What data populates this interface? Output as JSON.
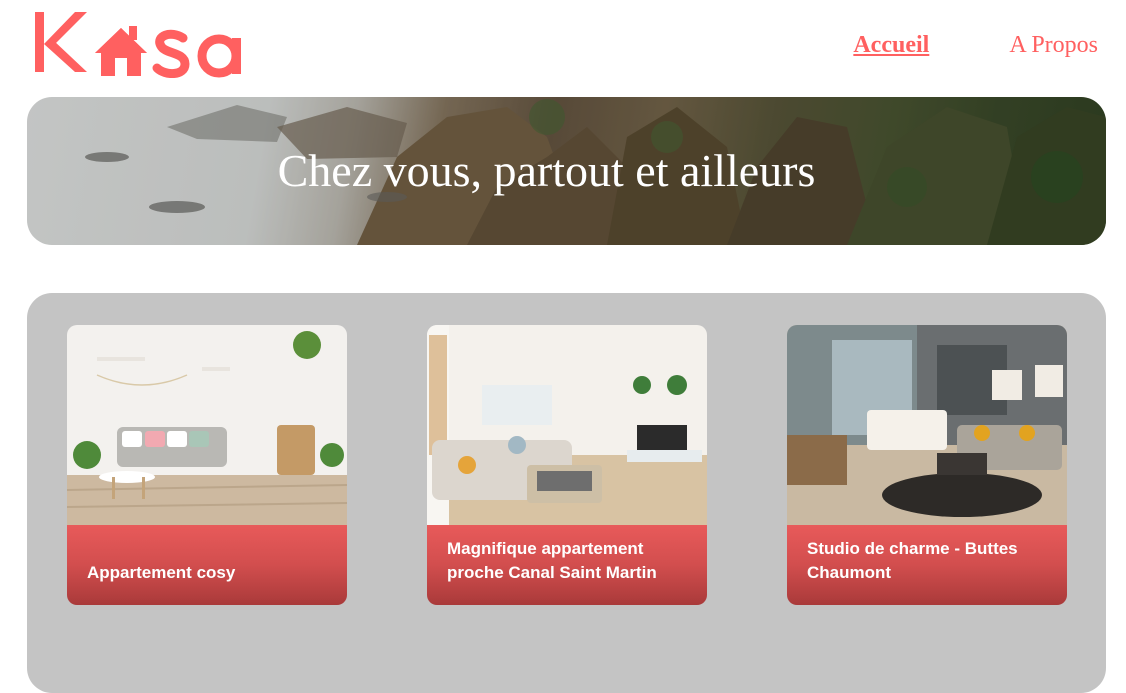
{
  "brand": {
    "name": "Kasa",
    "color": "#FF6060"
  },
  "nav": [
    {
      "label": "Accueil",
      "active": true
    },
    {
      "label": "A Propos",
      "active": false
    }
  ],
  "banner": {
    "title": "Chez vous, partout et ailleurs"
  },
  "colors": {
    "gallery_bg": "#C4C4C4",
    "caption_gradient_top": "#E85A5A",
    "caption_gradient_bottom": "#A93A3A"
  },
  "listings": [
    {
      "title": "Appartement cosy"
    },
    {
      "title": "Magnifique appartement proche Canal Saint Martin"
    },
    {
      "title": "Studio de charme - Buttes Chaumont"
    }
  ]
}
